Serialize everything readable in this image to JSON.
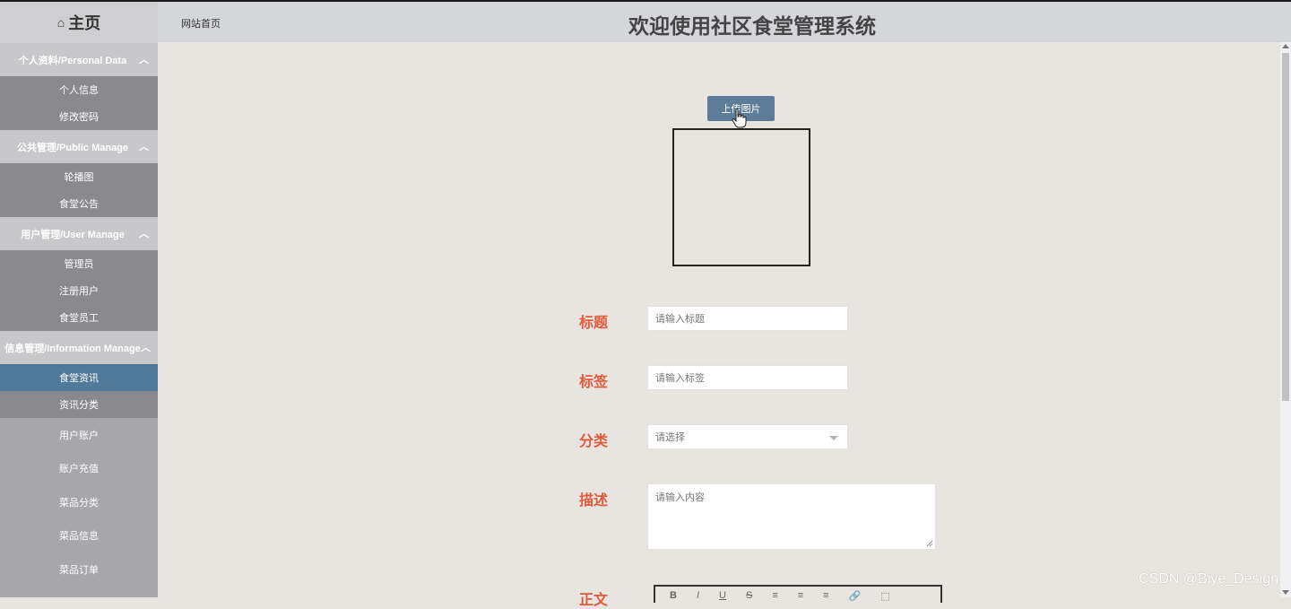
{
  "sidebar": {
    "home_label": "主页",
    "groups": [
      {
        "title": "个人资料/Personal Data",
        "items": [
          "个人信息",
          "修改密码"
        ]
      },
      {
        "title": "公共管理/Public Manage",
        "items": [
          "轮播图",
          "食堂公告"
        ]
      },
      {
        "title": "用户管理/User Manage",
        "items": [
          "管理员",
          "注册用户",
          "食堂员工"
        ]
      },
      {
        "title": "信息管理/Information Manage",
        "items": [
          "食堂资讯",
          "资讯分类"
        ]
      }
    ],
    "active_item": "食堂资讯",
    "plain_items": [
      "用户账户",
      "账户充值",
      "菜品分类",
      "菜品信息",
      "菜品订单"
    ]
  },
  "header": {
    "breadcrumb": "网站首页",
    "title": "欢迎使用社区食堂管理系统"
  },
  "form": {
    "upload_label": "上传图片",
    "fields": {
      "title": {
        "label": "标题",
        "placeholder": "请输入标题"
      },
      "tag": {
        "label": "标签",
        "placeholder": "请输入标签"
      },
      "category": {
        "label": "分类",
        "placeholder": "请选择"
      },
      "description": {
        "label": "描述",
        "placeholder": "请输入内容"
      },
      "body": {
        "label": "正文"
      }
    },
    "toolbar_buttons": [
      "B",
      "I",
      "U",
      "S",
      "≡",
      "≡",
      "≡",
      "🔗",
      "⬚"
    ]
  },
  "watermark": "CSDN @Biye_Design",
  "colors": {
    "accent": "#e05a3a",
    "active_nav": "#51799a",
    "upload_button": "#5c7c98"
  }
}
